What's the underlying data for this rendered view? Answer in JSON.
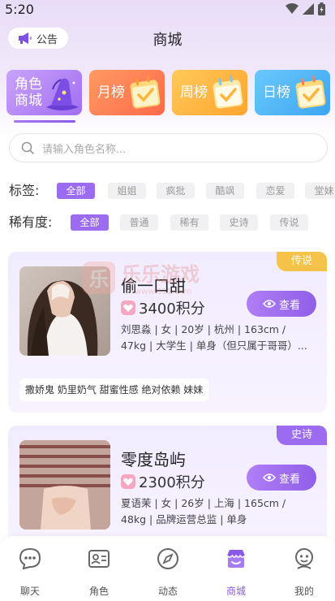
{
  "status_bar": {
    "time": "5:20"
  },
  "header": {
    "notice_label": "公告",
    "title": "商城"
  },
  "rank_tabs": [
    {
      "label_line1": "角色",
      "label_line2": "商城",
      "color": "#b485f5",
      "active": true
    },
    {
      "label": "月榜",
      "color": "#ff7e5a"
    },
    {
      "label": "周榜",
      "color": "#ffb43a"
    },
    {
      "label": "日榜",
      "color": "#4fb8f7"
    }
  ],
  "search": {
    "placeholder": "请输入角色名称..."
  },
  "tag_filter": {
    "label": "标签:",
    "options": [
      "全部",
      "姐姐",
      "疯批",
      "酷飒",
      "恋爱",
      "堂妹"
    ],
    "selected": "全部"
  },
  "rarity_filter": {
    "label": "稀有度:",
    "options": [
      "全部",
      "普通",
      "稀有",
      "史诗",
      "传说"
    ],
    "selected": "全部"
  },
  "watermark": {
    "text": "乐乐游戏",
    "url": "www.611.com"
  },
  "characters": [
    {
      "badge": "传说",
      "badge_color": "#f5c24a",
      "name": "偷一口甜",
      "price": "3400积分",
      "view_label": "查看",
      "description": "刘思淼 | 女 | 20岁 | 杭州 | 163cm / 47kg | 大学生 | 单身（但只属于哥哥）...",
      "tags": "撒娇鬼 奶里奶气 甜蜜性感 绝对依赖 妹妹"
    },
    {
      "badge": "史诗",
      "badge_color": "#9c6cf0",
      "name": "零度岛屿",
      "price": "2300积分",
      "view_label": "查看",
      "description": "夏语茉 | 女 | 26岁 | 上海 | 165cm / 48kg | 品牌运营总监 | 单身"
    }
  ],
  "tab_bar": [
    {
      "label": "聊天",
      "icon": "chat-icon"
    },
    {
      "label": "角色",
      "icon": "id-card-icon"
    },
    {
      "label": "动态",
      "icon": "compass-icon"
    },
    {
      "label": "商城",
      "icon": "store-icon",
      "active": true
    },
    {
      "label": "我的",
      "icon": "profile-icon"
    }
  ],
  "accent_color": "#8b5be8"
}
